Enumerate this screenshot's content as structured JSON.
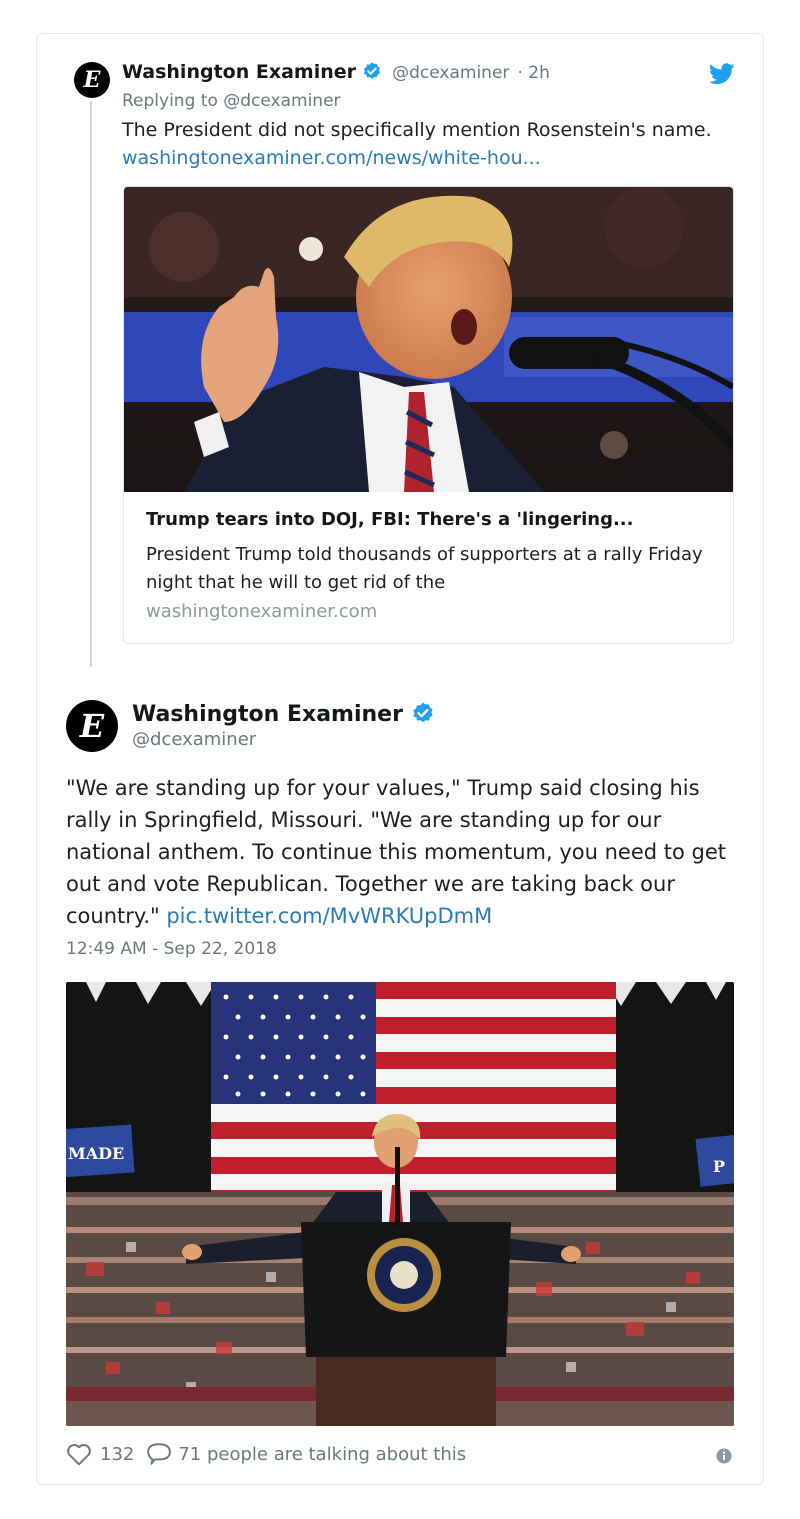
{
  "reply_tweet": {
    "name": "Washington Examiner",
    "handle": "@dcexaminer",
    "time": "· 2h",
    "replying_to": "Replying to @dcexaminer",
    "text": "The President did not specifically mention Rosenstein's name.",
    "link_text": "washingtonexaminer.com/news/white-hou...",
    "logo_letter": "E",
    "card": {
      "title": "Trump tears into DOJ, FBI: There's a 'lingering...",
      "description": "President Trump told thousands of supporters at a rally Friday night that he will to get rid of the",
      "domain": "washingtonexaminer.com"
    }
  },
  "main_tweet": {
    "name": "Washington Examiner",
    "handle": "@dcexaminer",
    "text": "\"We are standing up for your values,\" Trump said closing his rally in Springfield, Missouri. \"We are standing up for our national anthem. To continue this momentum, you need to get out and vote Republican. Together we are taking back our country.\"",
    "link_text": "pic.twitter.com/MvWRKUpDmM",
    "timestamp": "12:49 AM - Sep 22, 2018",
    "logo_letter": "E",
    "photo_banners": [
      "MADE",
      "P"
    ]
  },
  "footer": {
    "likes": "132",
    "talking": "71 people are talking about this"
  },
  "colors": {
    "link": "#2b7bb9",
    "verified": "#1da1f2",
    "muted": "#697882",
    "border": "#e1e8ed"
  },
  "icons": [
    "twitter-bird-icon",
    "verified-badge-icon",
    "heart-icon",
    "comment-icon",
    "info-icon"
  ]
}
